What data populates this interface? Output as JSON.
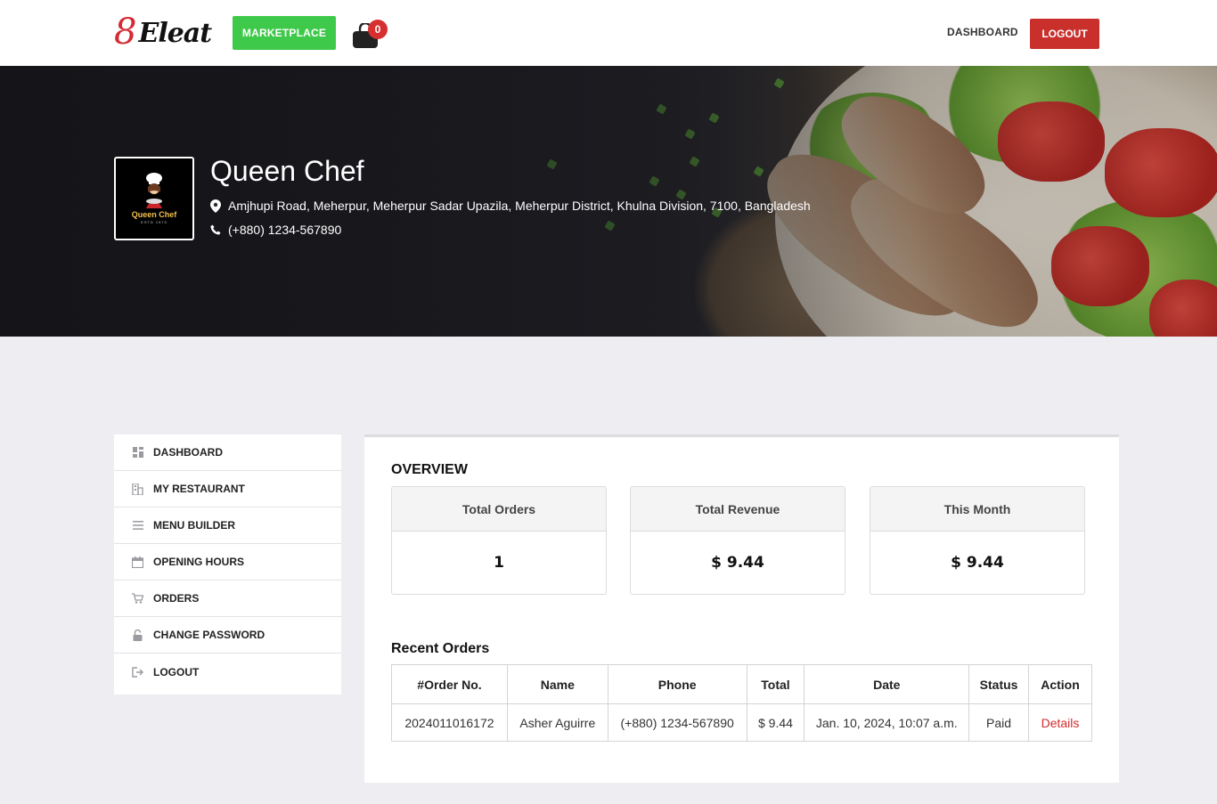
{
  "header": {
    "logo_number": "8",
    "logo_name": "Eleat",
    "marketplace_label": "MARKETPLACE",
    "cart_count": "0",
    "dashboard_label": "DASHBOARD",
    "logout_label": "LOGOUT"
  },
  "restaurant": {
    "logo_text": "Queen Chef",
    "logo_sub": "ESTD 1970",
    "name": "Queen Chef",
    "address": "Amjhupi Road, Meherpur, Meherpur Sadar Upazila, Meherpur District, Khulna Division, 7100, Bangladesh",
    "phone": "(+880) 1234-567890"
  },
  "sidebar": {
    "items": [
      {
        "label": "DASHBOARD",
        "icon": "dashboard-icon"
      },
      {
        "label": "MY RESTAURANT",
        "icon": "restaurant-icon"
      },
      {
        "label": "MENU BUILDER",
        "icon": "menu-icon"
      },
      {
        "label": "OPENING HOURS",
        "icon": "calendar-icon"
      },
      {
        "label": "ORDERS",
        "icon": "cart-icon"
      },
      {
        "label": "CHANGE PASSWORD",
        "icon": "lock-icon"
      },
      {
        "label": "LOGOUT",
        "icon": "sign-out-icon"
      }
    ]
  },
  "overview": {
    "title": "OVERVIEW",
    "stats": [
      {
        "label": "Total Orders",
        "value": "1"
      },
      {
        "label": "Total Revenue",
        "value": "$ 9.44"
      },
      {
        "label": "This Month",
        "value": "$ 9.44"
      }
    ]
  },
  "recent_orders": {
    "title": "Recent Orders",
    "columns": [
      "#Order No.",
      "Name",
      "Phone",
      "Total",
      "Date",
      "Status",
      "Action"
    ],
    "rows": [
      {
        "order_no": "2024011016172",
        "name": "Asher Aguirre",
        "phone": "(+880) 1234-567890",
        "total": "$ 9.44",
        "date": "Jan. 10, 2024, 10:07 a.m.",
        "status": "Paid",
        "action": "Details"
      }
    ]
  },
  "colors": {
    "brand_red": "#d42a34",
    "marketplace_green": "#3ec94a",
    "logout_red": "#c9302c",
    "details_link": "#d02b2b"
  }
}
